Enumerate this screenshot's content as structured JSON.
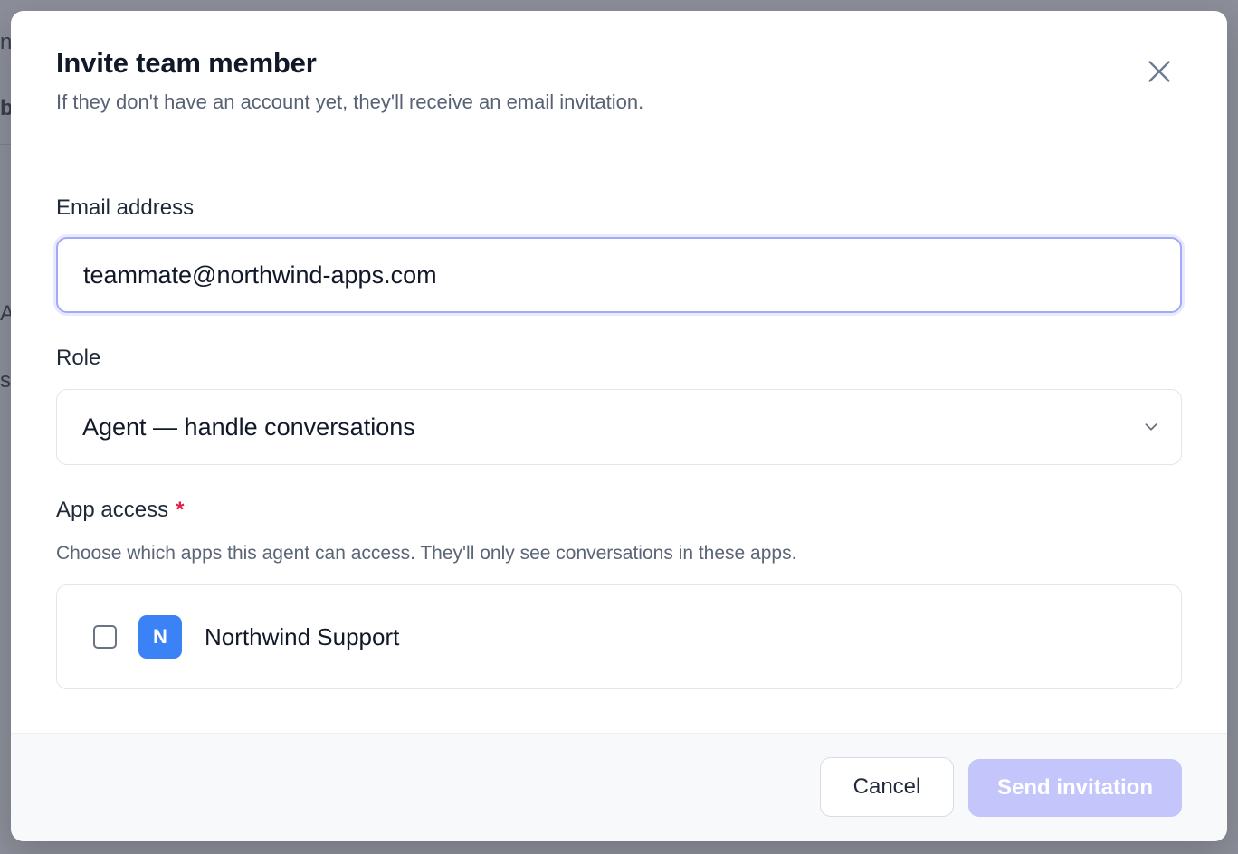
{
  "background": {
    "fragments": [
      "n",
      "b",
      "Al",
      "s"
    ]
  },
  "modal": {
    "title": "Invite team member",
    "subtitle": "If they don't have an account yet, they'll receive an email invitation.",
    "close_icon": "close-icon"
  },
  "email": {
    "label": "Email address",
    "value": "teammate@northwind-apps.com"
  },
  "role": {
    "label": "Role",
    "selected": "Agent — handle conversations",
    "chevron_icon": "chevron-down-icon"
  },
  "access": {
    "label": "App access",
    "required_mark": "*",
    "help": "Choose which apps this agent can access. They'll only see conversations in these apps.",
    "apps": [
      {
        "initial": "N",
        "name": "Northwind Support",
        "checked": false,
        "badge_color": "#3b82f6"
      }
    ]
  },
  "footer": {
    "cancel_label": "Cancel",
    "send_label": "Send invitation"
  },
  "colors": {
    "accent_disabled": "#c4c6fb",
    "focus_ring": "#a5a8f4",
    "required": "#e11d48"
  }
}
